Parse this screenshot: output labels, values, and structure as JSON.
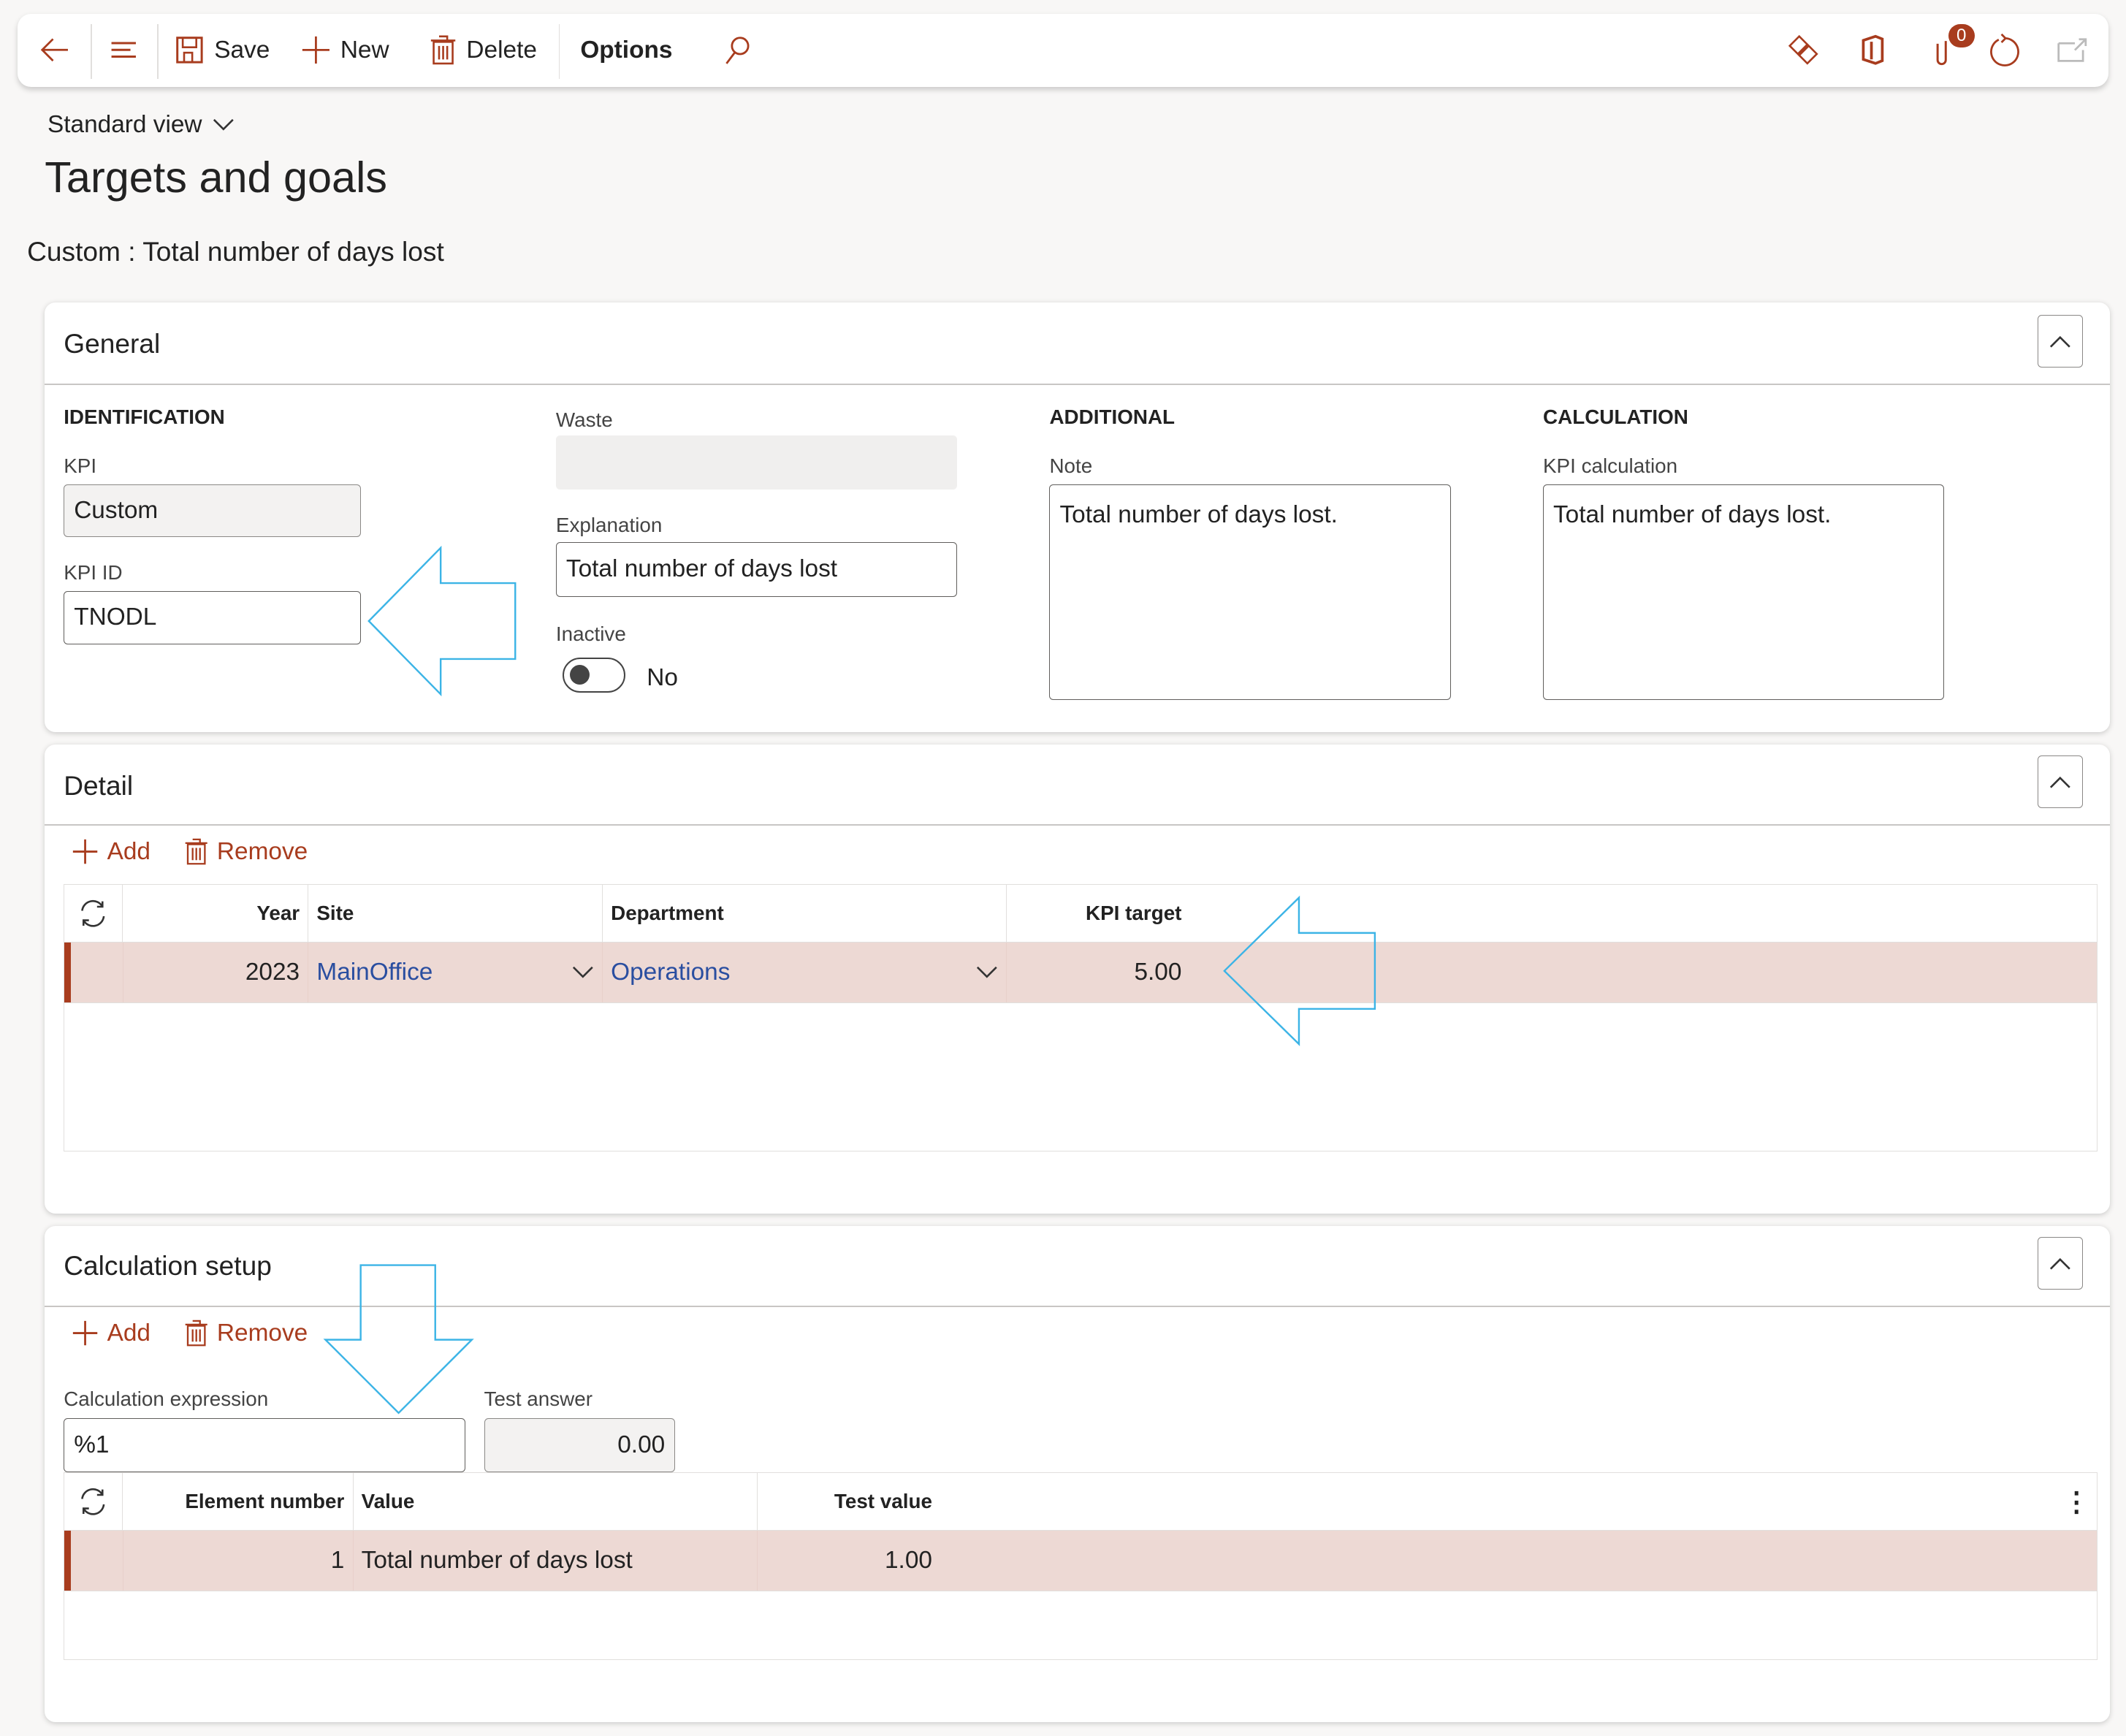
{
  "toolbar": {
    "save": "Save",
    "new": "New",
    "delete": "Delete",
    "options": "Options",
    "notification_count": "0"
  },
  "view_selector": "Standard view",
  "page_title": "Targets and goals",
  "record_title": "Custom : Total number of days lost",
  "general": {
    "title": "General",
    "identification_heading": "IDENTIFICATION",
    "kpi_label": "KPI",
    "kpi_value": "Custom",
    "kpi_id_label": "KPI ID",
    "kpi_id_value": "TNODL",
    "waste_label": "Waste",
    "waste_value": "",
    "explanation_label": "Explanation",
    "explanation_value": "Total number of days lost",
    "inactive_label": "Inactive",
    "inactive_value": "No",
    "inactive_on": false,
    "additional_heading": "ADDITIONAL",
    "note_label": "Note",
    "note_value": "Total number of days lost.",
    "calculation_heading": "CALCULATION",
    "kpi_calc_label": "KPI calculation",
    "kpi_calc_value": "Total number of days lost."
  },
  "detail": {
    "title": "Detail",
    "add": "Add",
    "remove": "Remove",
    "columns": [
      "Year",
      "Site",
      "Department",
      "KPI target"
    ],
    "rows": [
      {
        "year": "2023",
        "site": "MainOffice",
        "department": "Operations",
        "kpi_target": "5.00"
      }
    ]
  },
  "calc_setup": {
    "title": "Calculation setup",
    "add": "Add",
    "remove": "Remove",
    "expr_label": "Calculation expression",
    "expr_value": "%1",
    "test_answer_label": "Test answer",
    "test_answer_value": "0.00",
    "columns": [
      "Element number",
      "Value",
      "Test value"
    ],
    "rows": [
      {
        "element_number": "1",
        "value": "Total number of days lost",
        "test_value": "1.00"
      }
    ]
  },
  "colors": {
    "accent": "#a83c1e",
    "selected_row": "#edd9d4",
    "annotation_arrow": "#3cb4e6",
    "link": "#2a4ea0"
  }
}
